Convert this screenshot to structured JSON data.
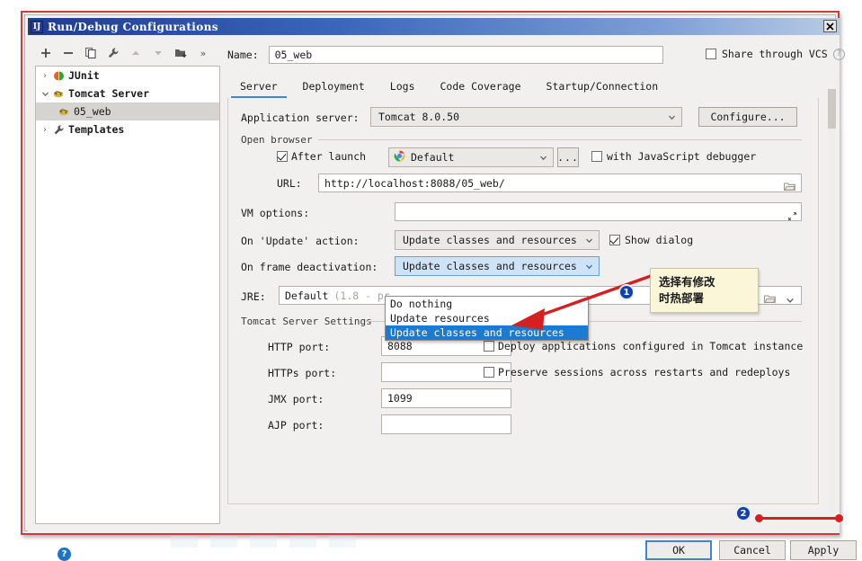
{
  "window": {
    "title": "Run/Debug Configurations",
    "icon": "idea-logo-icon",
    "close_label": "✕"
  },
  "toolbar": {
    "items": [
      {
        "name": "add-icon",
        "label": "+"
      },
      {
        "name": "remove-icon",
        "label": "−"
      },
      {
        "name": "copy-icon",
        "label": "copy"
      },
      {
        "name": "edit-templates-icon",
        "label": "wrench"
      },
      {
        "name": "move-up-icon",
        "label": "▲"
      },
      {
        "name": "move-down-icon",
        "label": "▼"
      },
      {
        "name": "new-folder-icon",
        "label": "folder-plus"
      },
      {
        "name": "more-icon",
        "label": "»"
      }
    ]
  },
  "tree": {
    "items": [
      {
        "arrow": "›",
        "icon": "junit-icon",
        "label": "JUnit",
        "selected": false,
        "child": false
      },
      {
        "arrow": "⌄",
        "icon": "tomcat-icon",
        "label": "Tomcat Server",
        "selected": false,
        "child": false
      },
      {
        "arrow": "",
        "icon": "tomcat-icon",
        "label": "05_web",
        "selected": true,
        "child": true
      },
      {
        "arrow": "›",
        "icon": "wrench-icon",
        "label": "Templates",
        "selected": false,
        "child": false
      }
    ]
  },
  "name_row": {
    "label": "Name:",
    "value": "05_web",
    "share_label": "Share through VCS",
    "share_checked": false,
    "help_glyph": "?"
  },
  "tabs": [
    {
      "label": "Server",
      "active": true
    },
    {
      "label": "Deployment",
      "active": false
    },
    {
      "label": "Logs",
      "active": false
    },
    {
      "label": "Code Coverage",
      "active": false
    },
    {
      "label": "Startup/Connection",
      "active": false
    }
  ],
  "server_tab": {
    "application_server": {
      "label": "Application server:",
      "value": "Tomcat 8.0.50",
      "configure_button": "Configure..."
    },
    "open_browser": {
      "group_title": "Open browser",
      "after_launch_label": "After launch",
      "after_launch_checked": true,
      "browser_value": "Default",
      "browser_icon": "chrome-icon",
      "ellipsis_button": "...",
      "js_debugger_label": "with JavaScript debugger",
      "js_debugger_checked": false,
      "url_label": "URL:",
      "url_value": "http://localhost:8088/05_web/",
      "url_browse_icon": "folder-icon"
    },
    "vm_options": {
      "label": "VM options:",
      "value": "",
      "expand_icon": "expand-icon"
    },
    "on_update": {
      "label": "On 'Update' action:",
      "value": "Update classes and resources",
      "show_dialog_label": "Show dialog",
      "show_dialog_checked": true
    },
    "on_frame_deactivation": {
      "label": "On frame deactivation:",
      "value": "Update classes and resources",
      "options": [
        "Do nothing",
        "Update resources",
        "Update classes and resources"
      ],
      "selected_option": "Update classes and resources"
    },
    "jre": {
      "label": "JRE:",
      "value": "Default",
      "value_hint": "(1.8 - pr",
      "browse_icon": "folder-icon",
      "dropdown_icon": "chevron-down-icon"
    },
    "tomcat_settings": {
      "group_title": "Tomcat Server Settings",
      "fields": [
        {
          "label": "HTTP port:",
          "value": "8088"
        },
        {
          "label": "HTTPs port:",
          "value": ""
        },
        {
          "label": "JMX port:",
          "value": "1099"
        },
        {
          "label": "AJP port:",
          "value": ""
        }
      ],
      "checkboxes": [
        {
          "label": "Deploy applications configured in Tomcat instance",
          "checked": false
        },
        {
          "label": "Preserve sessions across restarts and redeploys",
          "checked": false
        }
      ]
    }
  },
  "annotations": {
    "note_line1": "选择有修改",
    "note_line2": "时热部署",
    "badge_1": "1",
    "badge_2": "2"
  },
  "footer": {
    "help_glyph": "?",
    "ok_label": "OK",
    "cancel_label": "Cancel",
    "apply_label": "Apply"
  },
  "colors": {
    "accent_blue": "#3d86d4",
    "selection_blue": "#1c7ad1",
    "annotation_red": "#d42020",
    "badge_blue": "#1341a8",
    "note_yellow": "#fcf6d8",
    "titlebar_blue": "#1e3d8f"
  }
}
